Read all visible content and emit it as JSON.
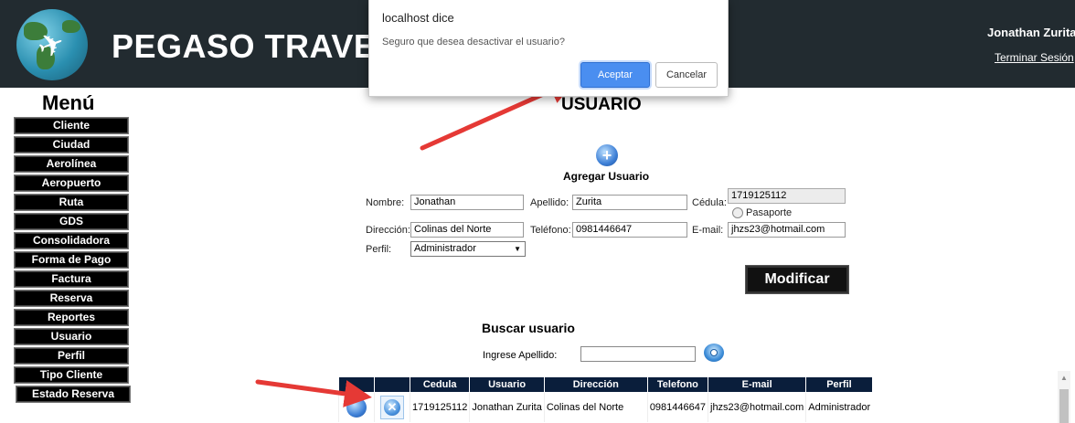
{
  "header": {
    "brand": "PEGASO TRAVEL",
    "user_name": "Jonathan Zurita",
    "logout_label": "Terminar Sesión"
  },
  "menu": {
    "title": "Menú",
    "items": [
      "Cliente",
      "Ciudad",
      "Aerolínea",
      "Aeropuerto",
      "Ruta",
      "GDS",
      "Consolidadora",
      "Forma de Pago",
      "Factura",
      "Reserva",
      "Reportes",
      "Usuario",
      "Perfil",
      "Tipo Cliente",
      "Estado Reserva"
    ]
  },
  "page": {
    "title": "USUARIO",
    "add_label": "Agregar Usuario"
  },
  "form": {
    "nombre_label": "Nombre:",
    "nombre_value": "Jonathan",
    "apellido_label": "Apellido:",
    "apellido_value": "Zurita",
    "cedula_label": "Cédula:",
    "cedula_value": "1719125112",
    "pasaporte_label": "Pasaporte",
    "direccion_label": "Dirección:",
    "direccion_value": "Colinas del Norte",
    "telefono_label": "Teléfono:",
    "telefono_value": "0981446647",
    "email_label": "E-mail:",
    "email_value": "jhzs23@hotmail.com",
    "perfil_label": "Perfil:",
    "perfil_value": "Administrador",
    "submit_label": "Modificar"
  },
  "search": {
    "title": "Buscar usuario",
    "label": "Ingrese Apellido:",
    "value": ""
  },
  "table": {
    "headers": [
      "Cedula",
      "Usuario",
      "Dirección",
      "Telefono",
      "E-mail",
      "Perfil"
    ],
    "rows": [
      {
        "cedula": "1719125112",
        "usuario": "Jonathan Zurita",
        "direccion": "Colinas del Norte",
        "telefono": "0981446647",
        "email": "jhzs23@hotmail.com",
        "perfil": "Administrador"
      }
    ]
  },
  "dialog": {
    "title": "localhost dice",
    "message": "Seguro que desea desactivar el usuario?",
    "ok_label": "Aceptar",
    "cancel_label": "Cancelar"
  },
  "annotation_color": "#e53935"
}
